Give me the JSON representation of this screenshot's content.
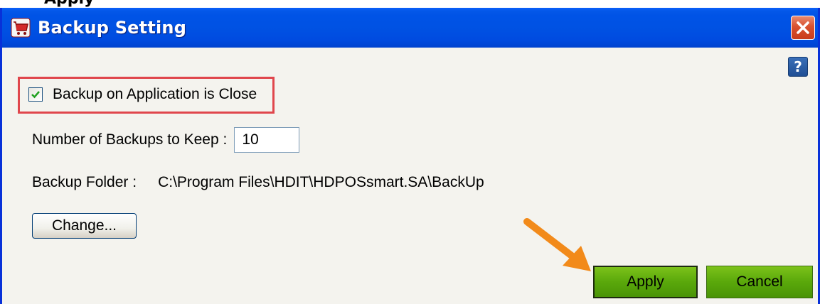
{
  "crop_text": "Apply",
  "window": {
    "title": "Backup Setting",
    "icons": {
      "app": "cart-icon",
      "close": "close-icon",
      "help": "help-icon"
    },
    "help_label": "?"
  },
  "form": {
    "backup_on_close": {
      "label": "Backup on Application is Close",
      "checked": true
    },
    "num_backups": {
      "label": "Number of Backups  to Keep :",
      "value": "10"
    },
    "backup_folder": {
      "label": "Backup Folder :",
      "path": "C:\\Program Files\\HDIT\\HDPOSsmart.SA\\BackUp"
    },
    "change_label": "Change..."
  },
  "buttons": {
    "apply_label": "Apply",
    "cancel_label": "Cancel"
  },
  "annotations": {
    "highlight_color": "#e0464c",
    "arrow_color": "#f28a1a",
    "arrow_icon": "arrow-pointer-icon"
  },
  "colors": {
    "titlebar": "#0053e6",
    "button_green": "#5aa80b",
    "close_red": "#d8512f"
  }
}
